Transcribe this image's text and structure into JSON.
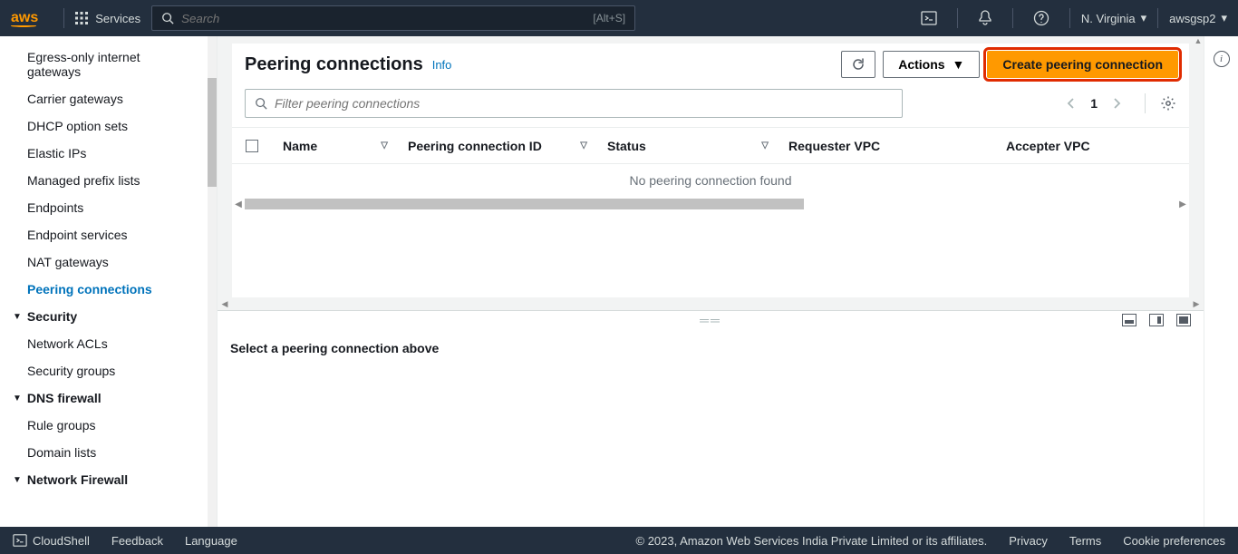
{
  "topnav": {
    "logo": "aws",
    "services_label": "Services",
    "search_placeholder": "Search",
    "search_kbd": "[Alt+S]",
    "region": "N. Virginia",
    "user": "awsgsp2"
  },
  "sidebar": {
    "items": [
      "Egress-only internet gateways",
      "Carrier gateways",
      "DHCP option sets",
      "Elastic IPs",
      "Managed prefix lists",
      "Endpoints",
      "Endpoint services",
      "NAT gateways",
      "Peering connections"
    ],
    "sections": [
      {
        "label": "Security",
        "items": [
          "Network ACLs",
          "Security groups"
        ]
      },
      {
        "label": "DNS firewall",
        "items": [
          "Rule groups",
          "Domain lists"
        ]
      },
      {
        "label": "Network Firewall",
        "items": []
      }
    ]
  },
  "panel": {
    "title": "Peering connections",
    "info_label": "Info",
    "actions_label": "Actions",
    "create_label": "Create peering connection",
    "filter_placeholder": "Filter peering connections",
    "page": "1",
    "columns": {
      "name": "Name",
      "pcid": "Peering connection ID",
      "status": "Status",
      "reqvpc": "Requester VPC",
      "accvpc": "Accepter VPC"
    },
    "empty": "No peering connection found"
  },
  "lower": {
    "message": "Select a peering connection above"
  },
  "footer": {
    "cloudshell": "CloudShell",
    "feedback": "Feedback",
    "language": "Language",
    "copyright": "© 2023, Amazon Web Services India Private Limited or its affiliates.",
    "privacy": "Privacy",
    "terms": "Terms",
    "cookies": "Cookie preferences"
  }
}
